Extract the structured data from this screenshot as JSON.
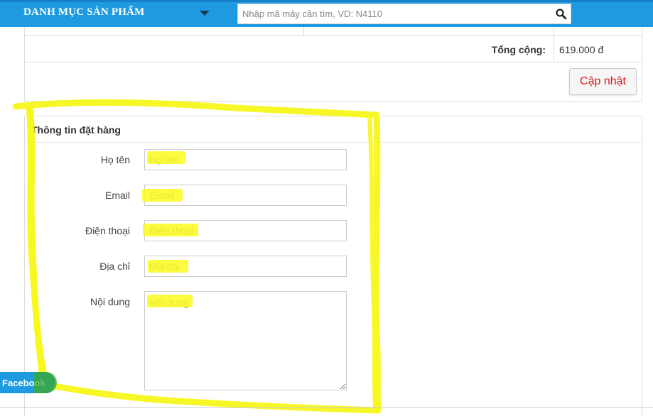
{
  "header": {
    "menu_title": "DANH MỤC SẢN PHẨM",
    "search_placeholder": "Nhập mã máy cần tìm, VD: N4110",
    "search_icon": "search-icon",
    "caret_icon": "caret-down-icon"
  },
  "cart": {
    "total_label": "Tổng cộng:",
    "total_value": "619.000 đ",
    "update_button": "Cập nhật"
  },
  "order_form": {
    "title": "Thông tin đặt hàng",
    "fields": [
      {
        "label": "Họ tên",
        "placeholder": "Họ tên"
      },
      {
        "label": "Email",
        "placeholder": "Email"
      },
      {
        "label": "Điện thoại",
        "placeholder": "Điện thoại"
      },
      {
        "label": "Địa chỉ",
        "placeholder": "Địa chỉ"
      },
      {
        "label": "Nội dung",
        "placeholder": "Nội dung"
      }
    ]
  },
  "floating": {
    "facebook_label": "Facebook"
  },
  "colors": {
    "nav_blue": "#1e9be0",
    "update_text": "#e0161c",
    "highlighter": "#fafa1e"
  }
}
